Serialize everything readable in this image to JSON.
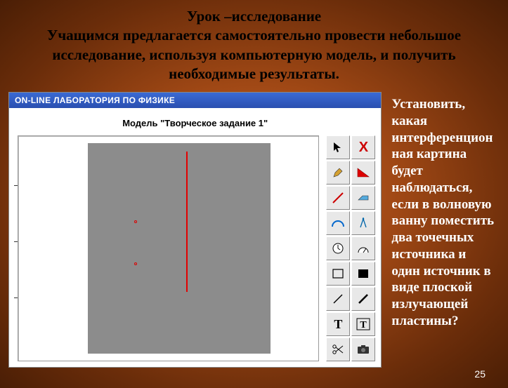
{
  "heading": {
    "line1": "Урок –исследование",
    "line2": "Учащимся предлагается самостоятельно провести небольшое исследование, используя компьютерную модель, и получить необходимые результаты."
  },
  "app": {
    "titlebar": "ON-LINE ЛАБОРАТОРИЯ ПО ФИЗИКЕ",
    "model_title": "Модель \"Творческое задание 1\""
  },
  "tools": {
    "pointer": "pointer",
    "x": "X",
    "pencil": "pencil",
    "triangle": "triangle",
    "inkline": "line",
    "eraser": "eraser",
    "arc": "arc",
    "compass": "compass",
    "clock": "clock",
    "gauge": "gauge",
    "rect_outline": "rect-outline",
    "rect_fill": "rect-fill",
    "slash": "line-slash",
    "slash2": "line-slash-2",
    "text": "T",
    "text_box": "T",
    "scissors": "scissors",
    "camera": "camera"
  },
  "side_text": "Установить, какая интерференцион ная картина будет наблюдаться, если в волновую ванну поместить два точечных источника и один источник в виде плоской излучающей пластины?",
  "page_number": "25"
}
